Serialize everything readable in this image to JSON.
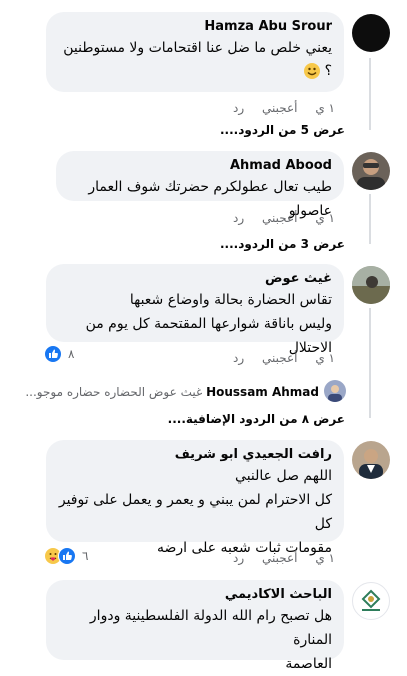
{
  "comments": [
    {
      "name": "Hamza Abu Srour",
      "text": "يعني خلص ما ضل عنا اقتحامات ولا مستوطنين",
      "text2": "؟",
      "time": "١ ي",
      "like_label": "أعجبني",
      "reply_label": "رد",
      "more_replies": "عرض 5 من الردود...."
    },
    {
      "name": "Ahmad Abood",
      "text": "طيب تعال عطولكرم حضرتك شوف العمار عاصولو",
      "time": "١ ي",
      "like_label": "أعجبني",
      "reply_label": "رد",
      "more_replies": "عرض 3 من الردود...."
    },
    {
      "name": "غيث عوض",
      "text": "تقاس الحضارة بحالة واوضاع شعبها",
      "text2": "وليس باناقة شوارعها المقتحمة كل يوم من الاحتلال",
      "time": "١ ي",
      "like_label": "أعجبني",
      "reply_label": "رد",
      "reaction_count": "٨",
      "reply_preview_name": "Houssam Ahmad",
      "reply_preview_text": "غيث عوض الحضاره حضاره موجو...",
      "more_replies": "عرض ٨ من الردود الإضافية...."
    },
    {
      "name": "رافت الجعيدي ابو شريف",
      "text": "اللهم صل عالنبي",
      "text2": "كل الاحترام لمن يبني و يعمر و يعمل على توفير كل",
      "text3": "مقومات ثبات شعبه على ارضه",
      "time": "١ ي",
      "like_label": "أعجبني",
      "reply_label": "رد",
      "reaction_count": "٦"
    },
    {
      "name": "الباحث الاكاديمي",
      "text": "هل تصبح رام الله الدولة الفلسطينية ودوار المنارة",
      "text2": "العاصمة"
    }
  ]
}
